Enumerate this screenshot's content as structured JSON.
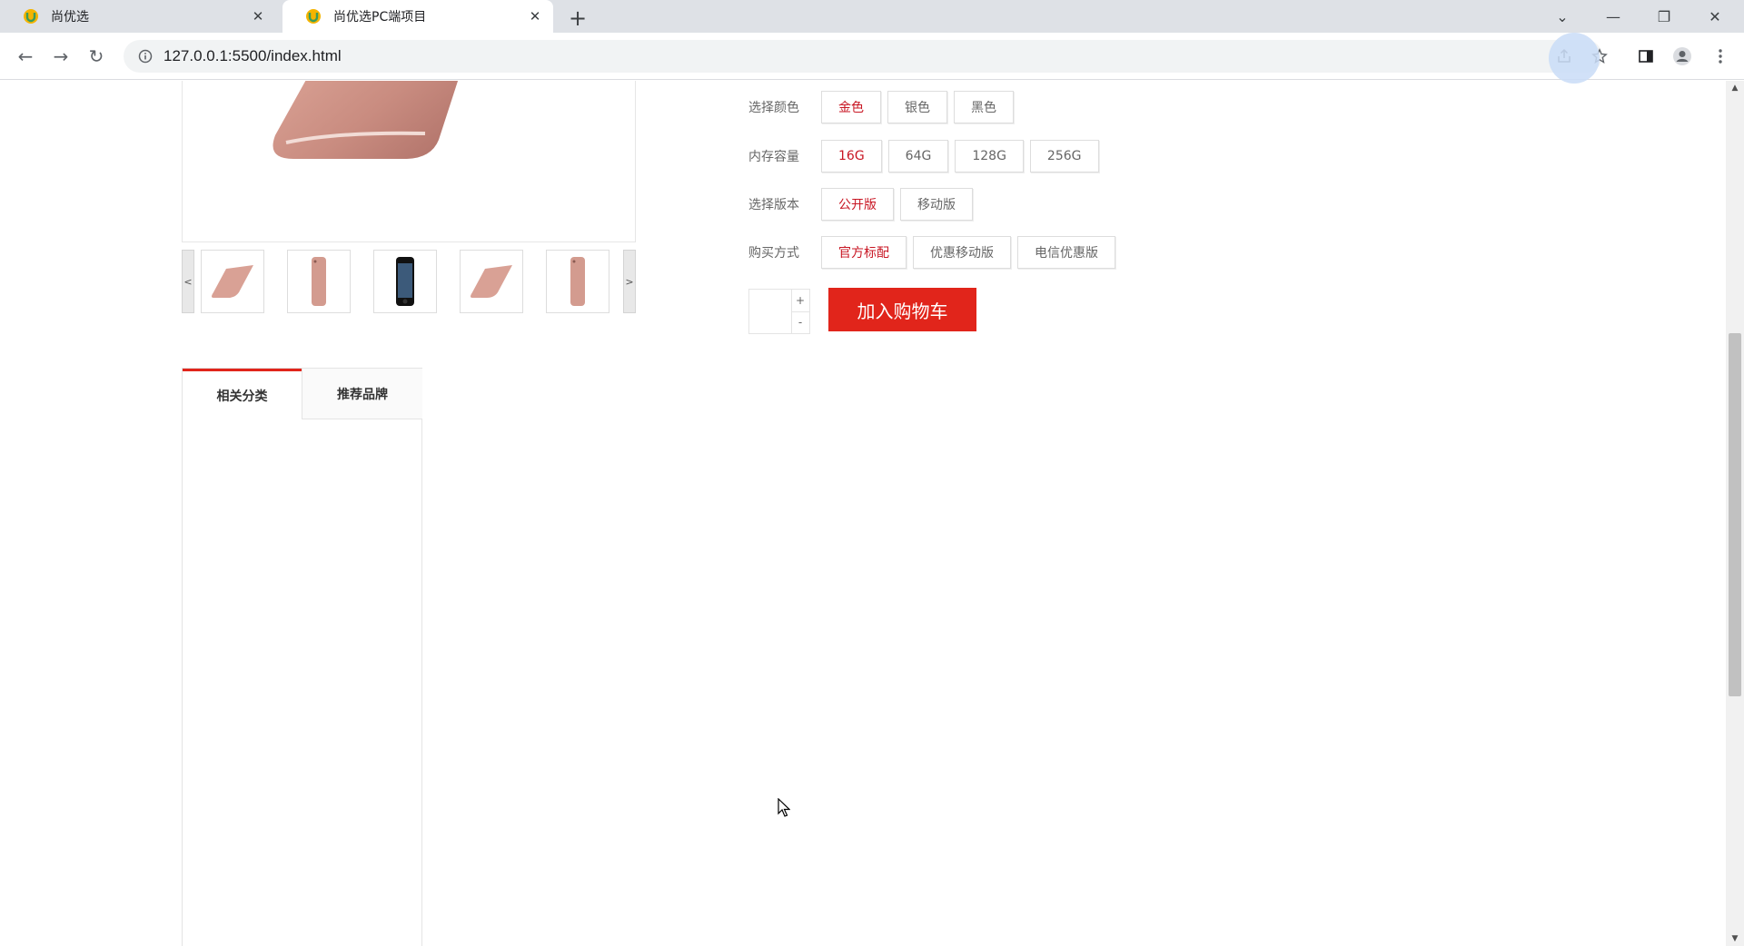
{
  "browser": {
    "tabs": [
      {
        "title": "尚优选",
        "active": false
      },
      {
        "title": "尚优选PC端项目",
        "active": true
      }
    ],
    "url": "127.0.0.1:5500/index.html"
  },
  "product": {
    "specs": [
      {
        "label": "选择颜色",
        "options": [
          "金色",
          "银色",
          "黑色"
        ],
        "selected": 0
      },
      {
        "label": "内存容量",
        "options": [
          "16G",
          "64G",
          "128G",
          "256G"
        ],
        "selected": 0
      },
      {
        "label": "选择版本",
        "options": [
          "公开版",
          "移动版"
        ],
        "selected": 0
      },
      {
        "label": "购买方式",
        "options": [
          "官方标配",
          "优惠移动版",
          "电信优惠版"
        ],
        "selected": 0
      }
    ],
    "quantity": {
      "value": "",
      "plus": "+",
      "minus": "-"
    },
    "add_to_cart": "加入购物车",
    "thumb_nav": {
      "prev": "<",
      "next": ">"
    },
    "thumbnails": [
      "phone-back-angle",
      "phone-back",
      "phone-front-black",
      "phone-back-angle",
      "phone-back"
    ]
  },
  "side_tabs": [
    "相关分类",
    "推荐品牌"
  ],
  "colors": {
    "accent": "#e1251b",
    "selected_text": "#c81623"
  }
}
